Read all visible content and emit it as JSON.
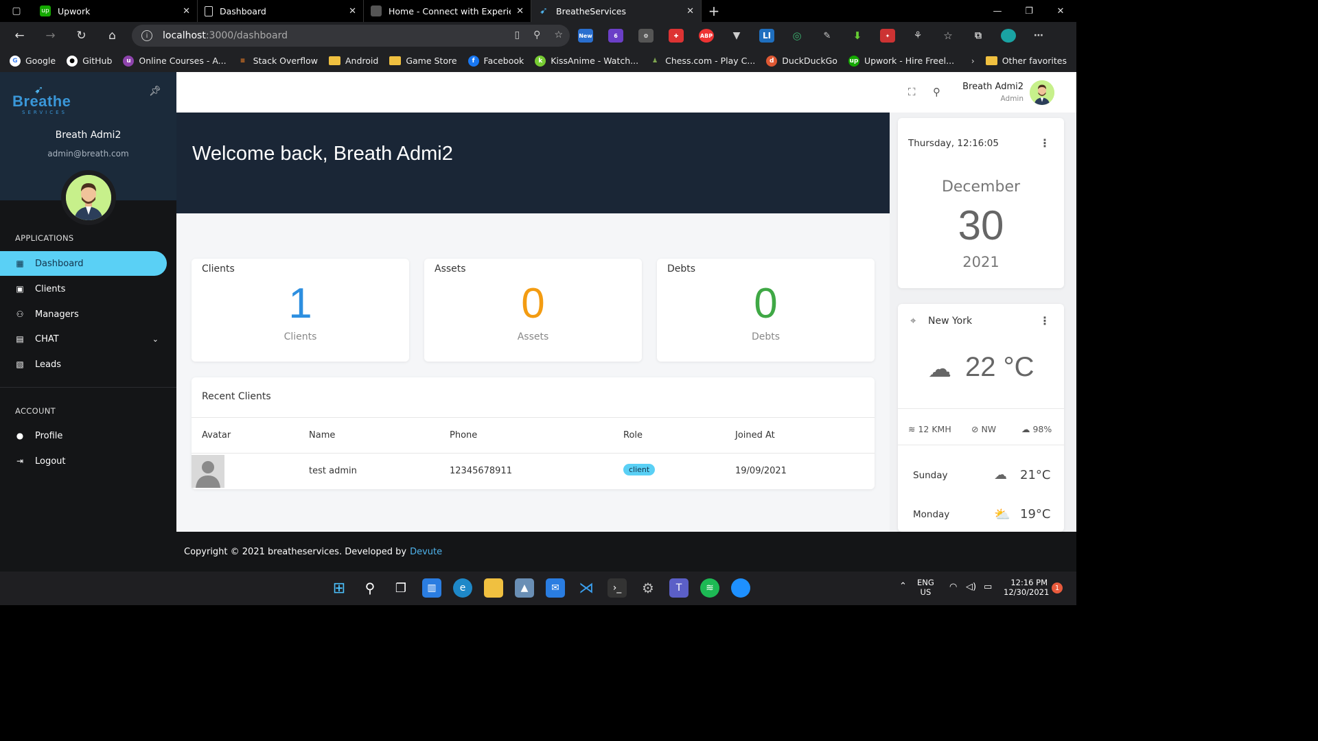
{
  "browser": {
    "tabs": [
      {
        "label": "Upwork",
        "favicon": "upwork-icon",
        "color": "#14a800"
      },
      {
        "label": "Dashboard",
        "favicon": "document-icon",
        "color": "#ddd"
      },
      {
        "label": "Home - Connect with Experience",
        "favicon": "site-icon",
        "color": "#888"
      },
      {
        "label": "BreatheServices",
        "favicon": "bird-icon",
        "color": "#4fb3ec"
      }
    ],
    "url_host": "localhost",
    "url_path": ":3000/dashboard",
    "extension_new_badge": "New",
    "extension_count": "6",
    "bookmarks": [
      {
        "label": "Google"
      },
      {
        "label": "GitHub"
      },
      {
        "label": "Online Courses - A..."
      },
      {
        "label": "Stack Overflow"
      },
      {
        "label": "Android"
      },
      {
        "label": "Game Store"
      },
      {
        "label": "Facebook"
      },
      {
        "label": "KissAnime - Watch..."
      },
      {
        "label": "Chess.com - Play C..."
      },
      {
        "label": "DuckDuckGo"
      },
      {
        "label": "Upwork - Hire Freel..."
      }
    ],
    "other_favorites": "Other favorites"
  },
  "sidebar": {
    "logo_text": "Breathe",
    "logo_sub": "SERVICES",
    "user_name": "Breath Admi2",
    "user_email": "admin@breath.com",
    "section_apps": "APPLICATIONS",
    "section_account": "ACCOUNT",
    "apps": [
      {
        "label": "Dashboard",
        "icon": "grid-icon"
      },
      {
        "label": "Clients",
        "icon": "contact-icon"
      },
      {
        "label": "Managers",
        "icon": "users-icon"
      },
      {
        "label": "CHAT",
        "icon": "chat-icon"
      },
      {
        "label": "Leads",
        "icon": "leads-icon"
      }
    ],
    "account": [
      {
        "label": "Profile",
        "icon": "person-icon"
      },
      {
        "label": "Logout",
        "icon": "logout-icon"
      }
    ]
  },
  "header": {
    "user_name": "Breath Admi2",
    "user_role": "Admin"
  },
  "main": {
    "welcome": "Welcome back, Breath Admi2",
    "stats": [
      {
        "title": "Clients",
        "value": "1",
        "label": "Clients",
        "color": "#2d8fe0"
      },
      {
        "title": "Assets",
        "value": "0",
        "label": "Assets",
        "color": "#f39c12"
      },
      {
        "title": "Debts",
        "value": "0",
        "label": "Debts",
        "color": "#3fa845"
      }
    ],
    "recent": {
      "title": "Recent Clients",
      "columns": [
        "Avatar",
        "Name",
        "Phone",
        "Role",
        "Joined At"
      ],
      "rows": [
        {
          "name": "test admin",
          "phone": "12345678911",
          "role": "client",
          "joined": "19/09/2021"
        }
      ]
    }
  },
  "footer": {
    "text": "Copyright © 2021 breatheservices. Developed by",
    "link": "Devute"
  },
  "calendar": {
    "time": "Thursday, 12:16:05",
    "month": "December",
    "day": "30",
    "year": "2021"
  },
  "weather": {
    "city": "New York",
    "temp": "22 °C",
    "wind": "12 KMH",
    "direction": "NW",
    "humidity": "98%",
    "forecast": [
      {
        "day": "Sunday",
        "temp": "21°C",
        "icon": "cloud-icon"
      },
      {
        "day": "Monday",
        "temp": "19°C",
        "icon": "sun-cloud-icon"
      }
    ]
  },
  "taskbar": {
    "lang": "ENG",
    "region": "US",
    "time": "12:16 PM",
    "date": "12/30/2021",
    "notifications": "1"
  }
}
